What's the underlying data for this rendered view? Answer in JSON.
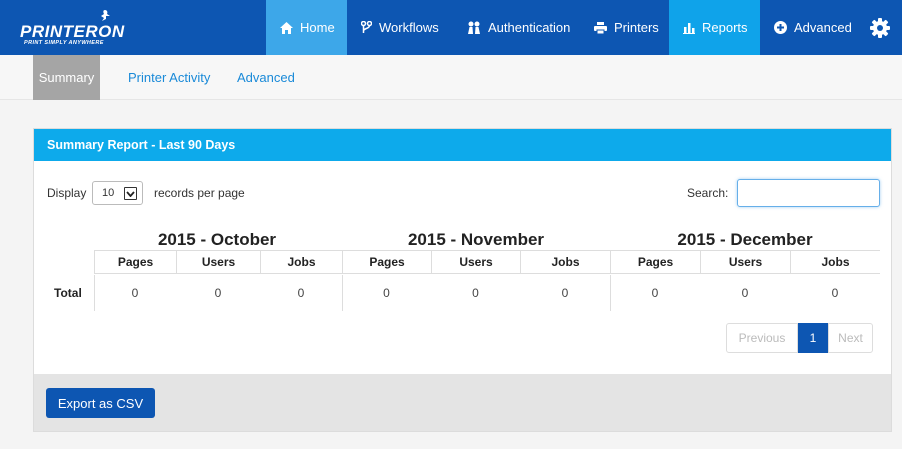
{
  "brand": {
    "name": "PRINTERON",
    "tagline": "PRINT SIMPLY ANYWHERE"
  },
  "nav": {
    "items": [
      {
        "label": "Home",
        "icon": "home-icon"
      },
      {
        "label": "Workflows",
        "icon": "workflow-icon"
      },
      {
        "label": "Authentication",
        "icon": "authentication-icon"
      },
      {
        "label": "Printers",
        "icon": "printer-icon"
      },
      {
        "label": "Reports",
        "icon": "bar-chart-icon"
      },
      {
        "label": "Advanced",
        "icon": "plus-circle-icon"
      }
    ],
    "settings_icon": "gear-icon"
  },
  "subnav": {
    "items": [
      {
        "label": "Summary"
      },
      {
        "label": "Printer Activity"
      },
      {
        "label": "Advanced"
      }
    ]
  },
  "panel": {
    "title": "Summary Report - Last 90 Days",
    "display_label": "Display",
    "records_value": "10",
    "per_page_label": "records per page",
    "search_label": "Search:",
    "search_value": ""
  },
  "report": {
    "months": [
      "2015 - October",
      "2015 - November",
      "2015 - December"
    ],
    "columns": [
      "Pages",
      "Users",
      "Jobs",
      "Pages",
      "Users",
      "Jobs",
      "Pages",
      "Users",
      "Jobs"
    ],
    "row_label": "Total",
    "values": [
      "0",
      "0",
      "0",
      "0",
      "0",
      "0",
      "0",
      "0",
      "0"
    ]
  },
  "pager": {
    "previous": "Previous",
    "current": "1",
    "next": "Next"
  },
  "footer": {
    "export_label": "Export as CSV"
  },
  "colors": {
    "navbar": "#0d56b2",
    "home_active": "#3da7e9",
    "reports_active": "#0fa3ea",
    "panel_header": "#0daaeb",
    "button": "#0d56b2"
  }
}
